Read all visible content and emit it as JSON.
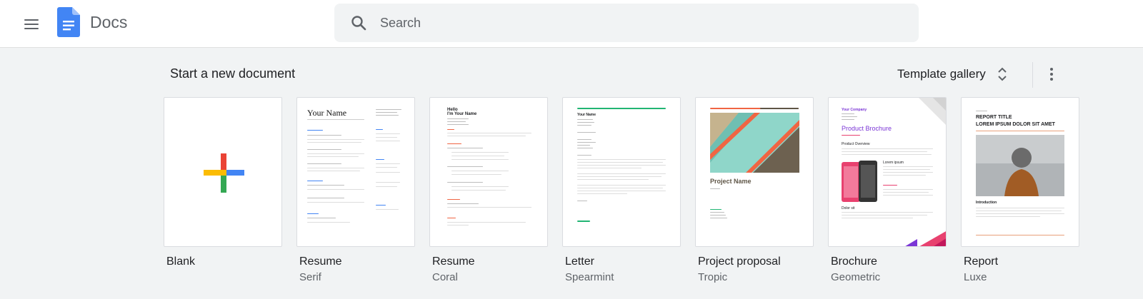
{
  "header": {
    "app_title": "Docs",
    "search_placeholder": "Search"
  },
  "section": {
    "title": "Start a new document",
    "gallery_label": "Template gallery"
  },
  "templates": [
    {
      "name": "Blank",
      "sub": ""
    },
    {
      "name": "Resume",
      "sub": "Serif",
      "preview": {
        "heading": "Your Name"
      }
    },
    {
      "name": "Resume",
      "sub": "Coral",
      "preview": {
        "heading": "Hello\nI'm Your Name"
      }
    },
    {
      "name": "Letter",
      "sub": "Spearmint",
      "preview": {
        "heading": "Your Name"
      }
    },
    {
      "name": "Project proposal",
      "sub": "Tropic",
      "preview": {
        "heading": "Project Name"
      }
    },
    {
      "name": "Brochure",
      "sub": "Geometric",
      "preview": {
        "company": "Your Company",
        "heading": "Product Brochure",
        "overview": "Product Overview",
        "lorem": "Lorem ipsum",
        "dolor": "Dolor sit"
      }
    },
    {
      "name": "Report",
      "sub": "Luxe",
      "preview": {
        "heading": "REPORT TITLE",
        "subheading": "LOREM IPSUM DOLOR SIT AMET",
        "intro": "Introduction"
      }
    }
  ],
  "colors": {
    "docs_blue": "#4285f4",
    "google_red": "#ea4335",
    "google_yellow": "#fbbc04",
    "google_green": "#34a853",
    "coral": "#f06543",
    "spearmint": "#21b573",
    "brochure_purple": "#7b36d6",
    "brochure_pink": "#e8416f"
  }
}
